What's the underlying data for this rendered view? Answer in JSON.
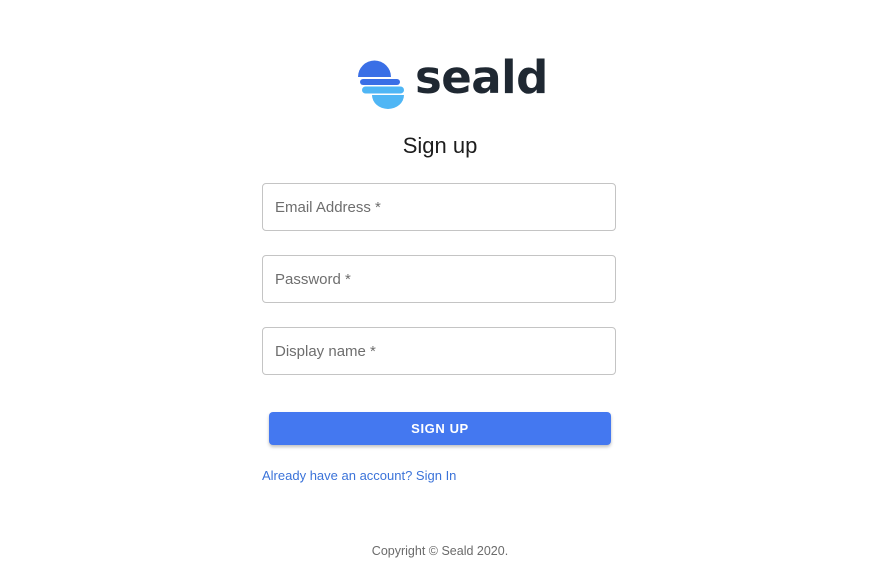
{
  "brand": {
    "name": "seald",
    "colors": {
      "logo_top": "#3a6fe6",
      "logo_bottom": "#4fb6f5",
      "text_dark": "#1f2832"
    }
  },
  "page_title": "Sign up",
  "form": {
    "email_placeholder": "Email Address *",
    "password_placeholder": "Password *",
    "display_name_placeholder": "Display name *",
    "email_value": "",
    "password_value": "",
    "display_name_value": ""
  },
  "submit_label": "SIGN UP",
  "signin_link": "Already have an account? Sign In",
  "footer": {
    "copyright": "Copyright © Seald 2020."
  },
  "accent_color": "#4478f0",
  "link_color": "#3b73d9"
}
